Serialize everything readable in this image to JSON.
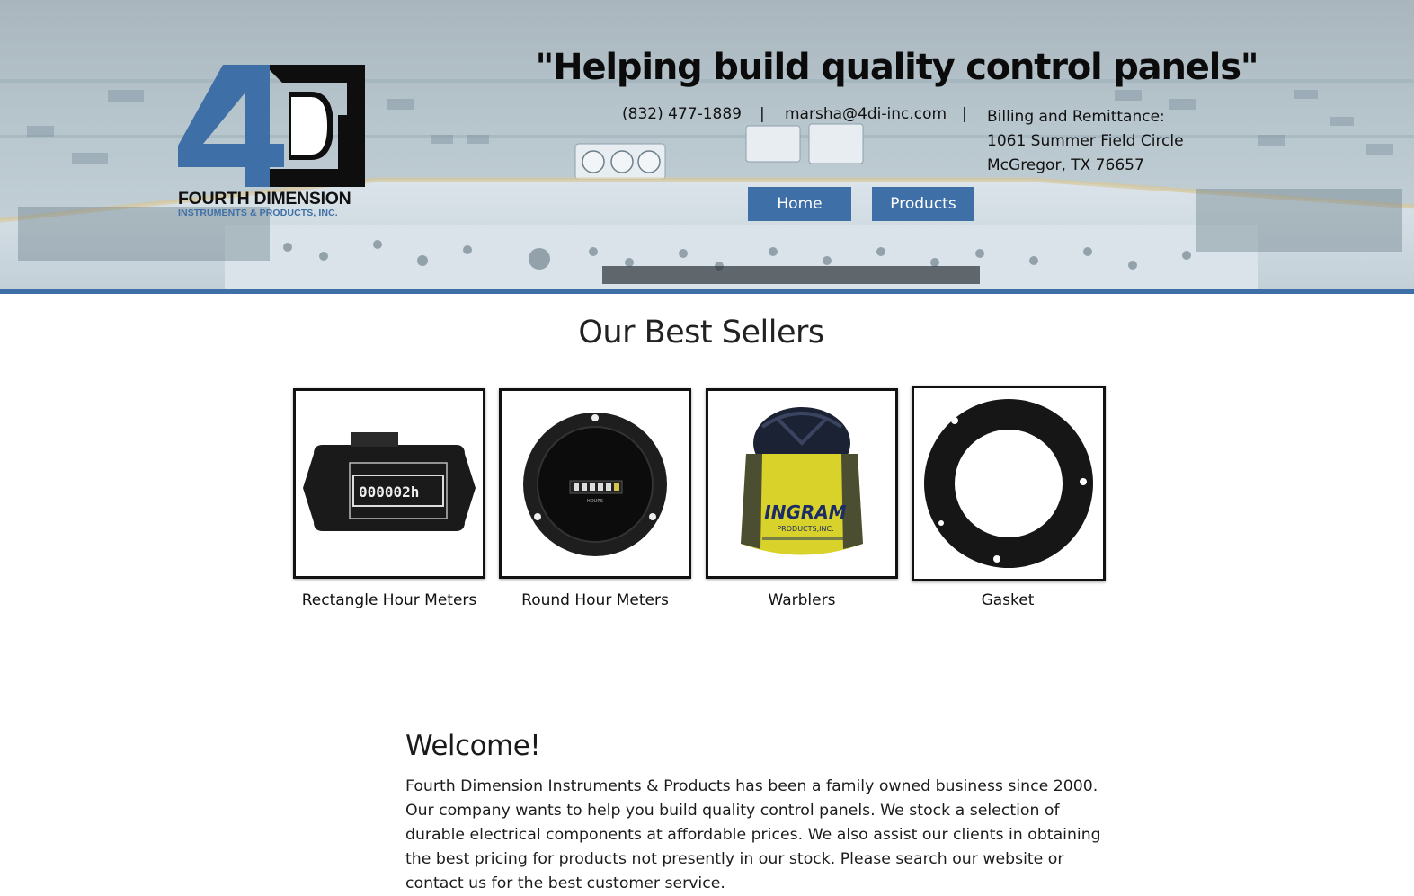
{
  "header": {
    "logo": {
      "mark": "4D",
      "name": "FOURTH DIMENSION",
      "subtitle": "INSTRUMENTS & PRODUCTS, INC."
    },
    "tagline": "\"Helping build quality control panels\"",
    "phone": "(832) 477-1889",
    "separator": "|",
    "email": "marsha@4di-inc.com",
    "billing": {
      "label": "Billing and Remittance:",
      "street": "1061 Summer Field Circle",
      "city": "McGregor, TX 76657"
    },
    "nav": [
      {
        "label": "Home"
      },
      {
        "label": "Products"
      }
    ],
    "colors": {
      "accent": "#3e6fa6",
      "hero_tint": "#b9c7cf"
    }
  },
  "best_sellers": {
    "title": "Our Best Sellers",
    "products": [
      {
        "name": "Rectangle Hour Meters",
        "icon": "rectangle-hour-meter-image",
        "counter": "000002h"
      },
      {
        "name": "Round Hour Meters",
        "icon": "round-hour-meter-image",
        "counter": "HOURS"
      },
      {
        "name": "Warblers",
        "icon": "warbler-image",
        "label": "INGRAM",
        "label_sub": "PRODUCTS,INC."
      },
      {
        "name": "Gasket",
        "icon": "gasket-image"
      }
    ]
  },
  "welcome": {
    "title": "Welcome!",
    "body": "Fourth Dimension Instruments & Products has been a family owned business since 2000. Our company wants to help you build quality control panels. We stock a selection of durable electrical components at affordable prices. We also assist our clients in obtaining the best pricing for products not presently in our stock. Please search our website or contact us for the best customer service."
  }
}
